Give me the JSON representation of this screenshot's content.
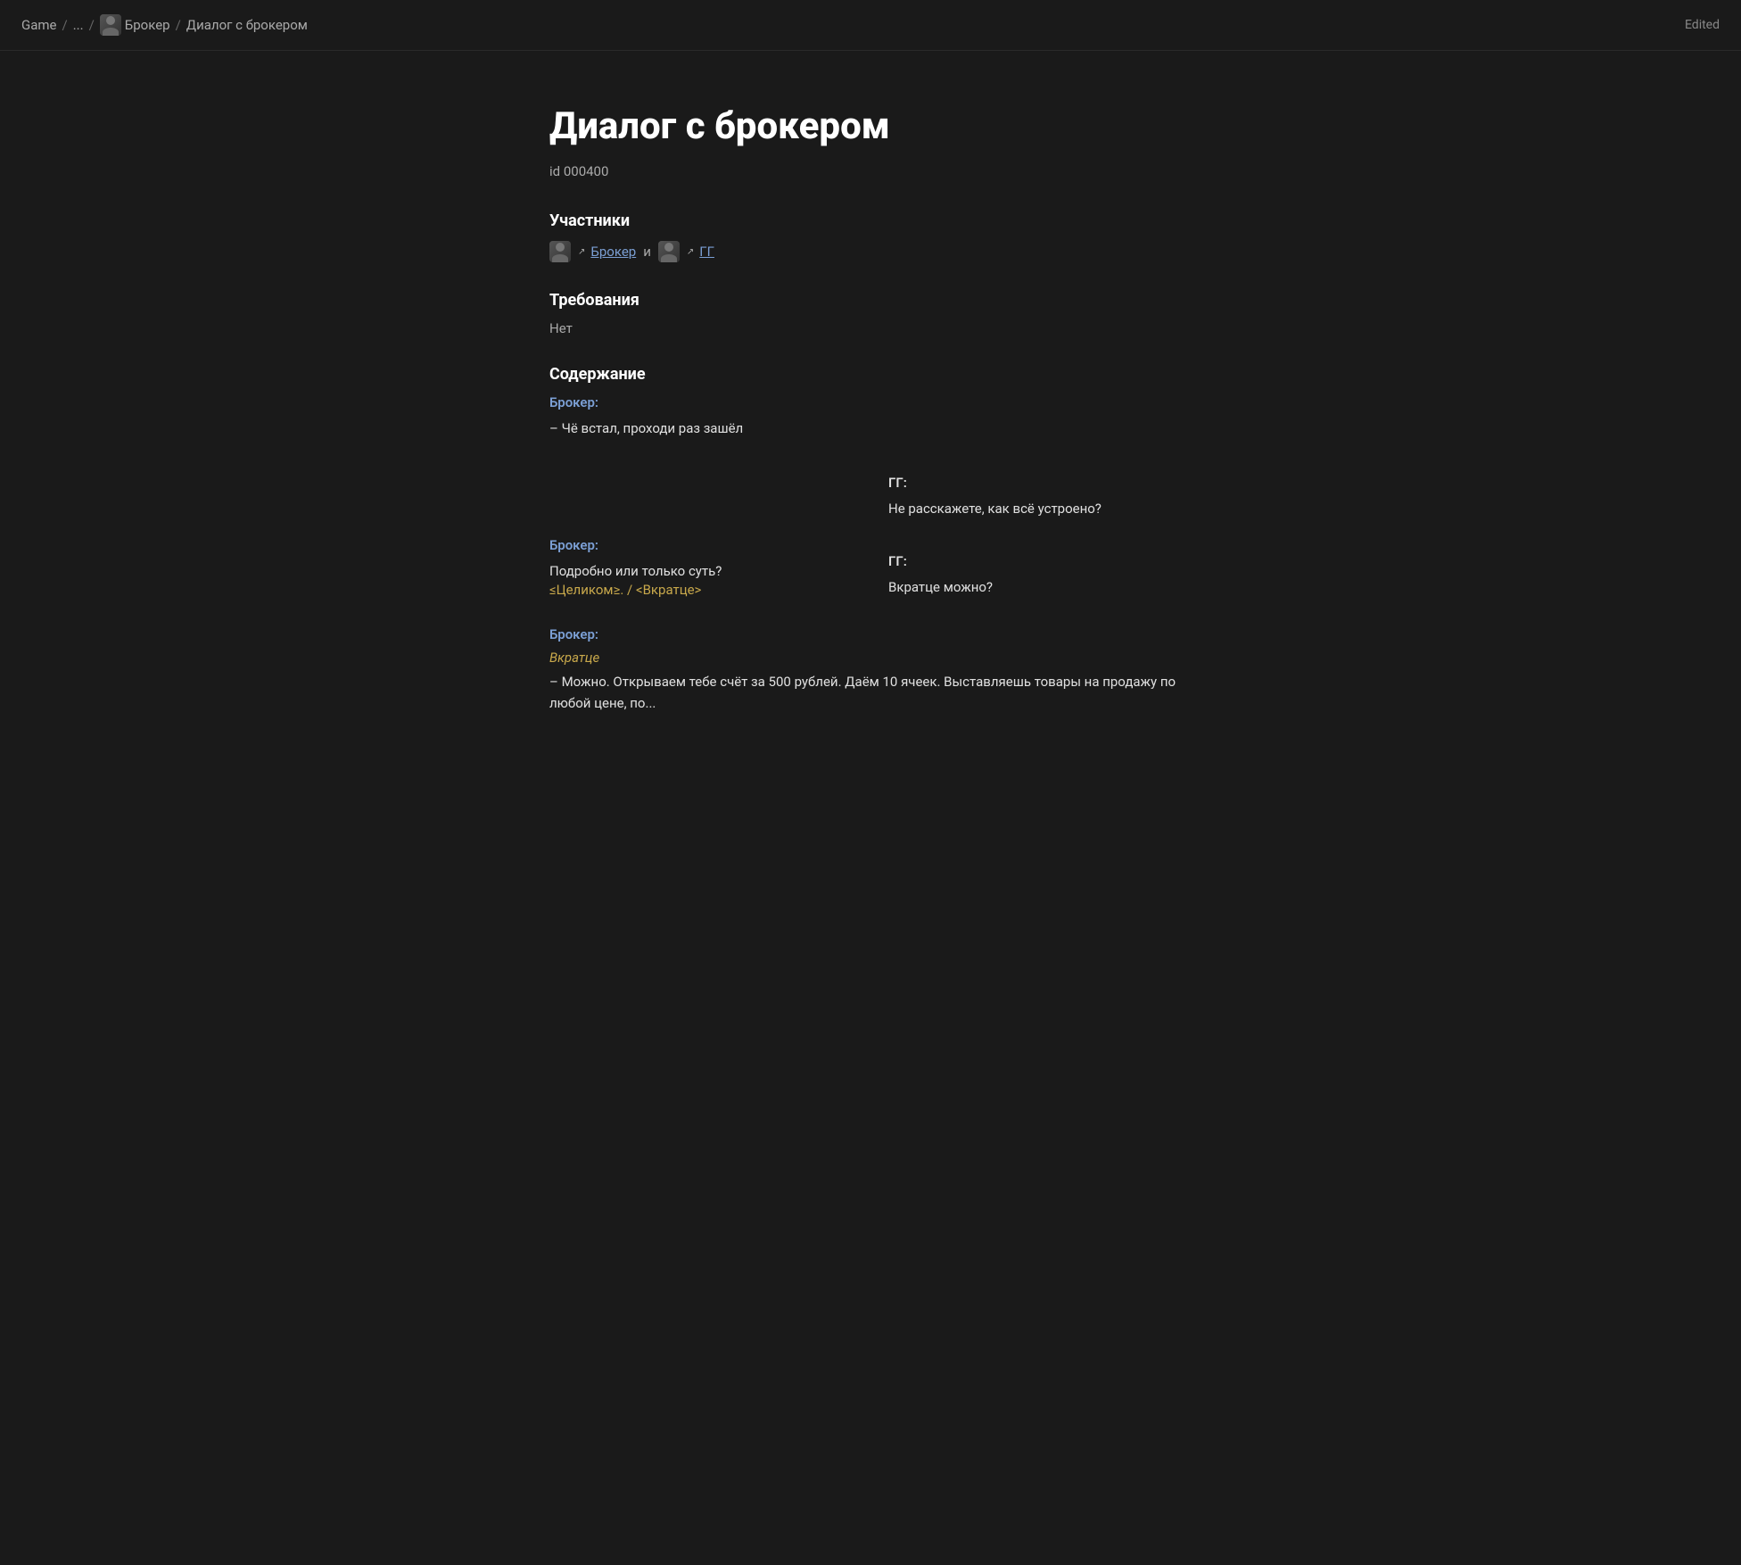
{
  "header": {
    "breadcrumb": [
      {
        "label": "Game",
        "type": "text"
      },
      {
        "label": "...",
        "type": "text"
      },
      {
        "label": "Брокер",
        "type": "avatar-link"
      },
      {
        "label": "Диалог с брокером",
        "type": "text"
      }
    ],
    "edited_label": "Edited"
  },
  "page": {
    "title": "Диалог с брокером",
    "id_label": "id 000400",
    "sections": {
      "participants": {
        "title": "Участники",
        "broker_name": "Брокер",
        "and_text": "и",
        "gg_name": "ГГ"
      },
      "requirements": {
        "title": "Требования",
        "content": "Нет"
      },
      "content": {
        "title": "Содержание"
      }
    },
    "dialog": [
      {
        "id": 1,
        "speaker": "Брокер:",
        "speaker_type": "broker",
        "text": "– Чё встал, проходи раз зашёл",
        "position": "left"
      },
      {
        "id": 2,
        "speaker": "ГГ:",
        "speaker_type": "gg",
        "text": "Не расскажете, как всё устроено?",
        "position": "right"
      },
      {
        "id": 3,
        "speaker": "Брокер:",
        "speaker_type": "broker",
        "text": "Подробно или только суть?",
        "options": "≤Целиком≥. / <Вкратце>",
        "position": "left"
      },
      {
        "id": 4,
        "speaker": "ГГ:",
        "speaker_type": "gg",
        "text": "Вкратце можно?",
        "position": "right"
      },
      {
        "id": 5,
        "speaker": "Брокер:",
        "speaker_type": "broker",
        "italic": "Вкратце",
        "text": "– Можно. Открываем тебе счёт за 500 рублей. Даём 10 ячеек. Выставляешь товары на продажу по любой цене, по...",
        "position": "left"
      }
    ]
  }
}
